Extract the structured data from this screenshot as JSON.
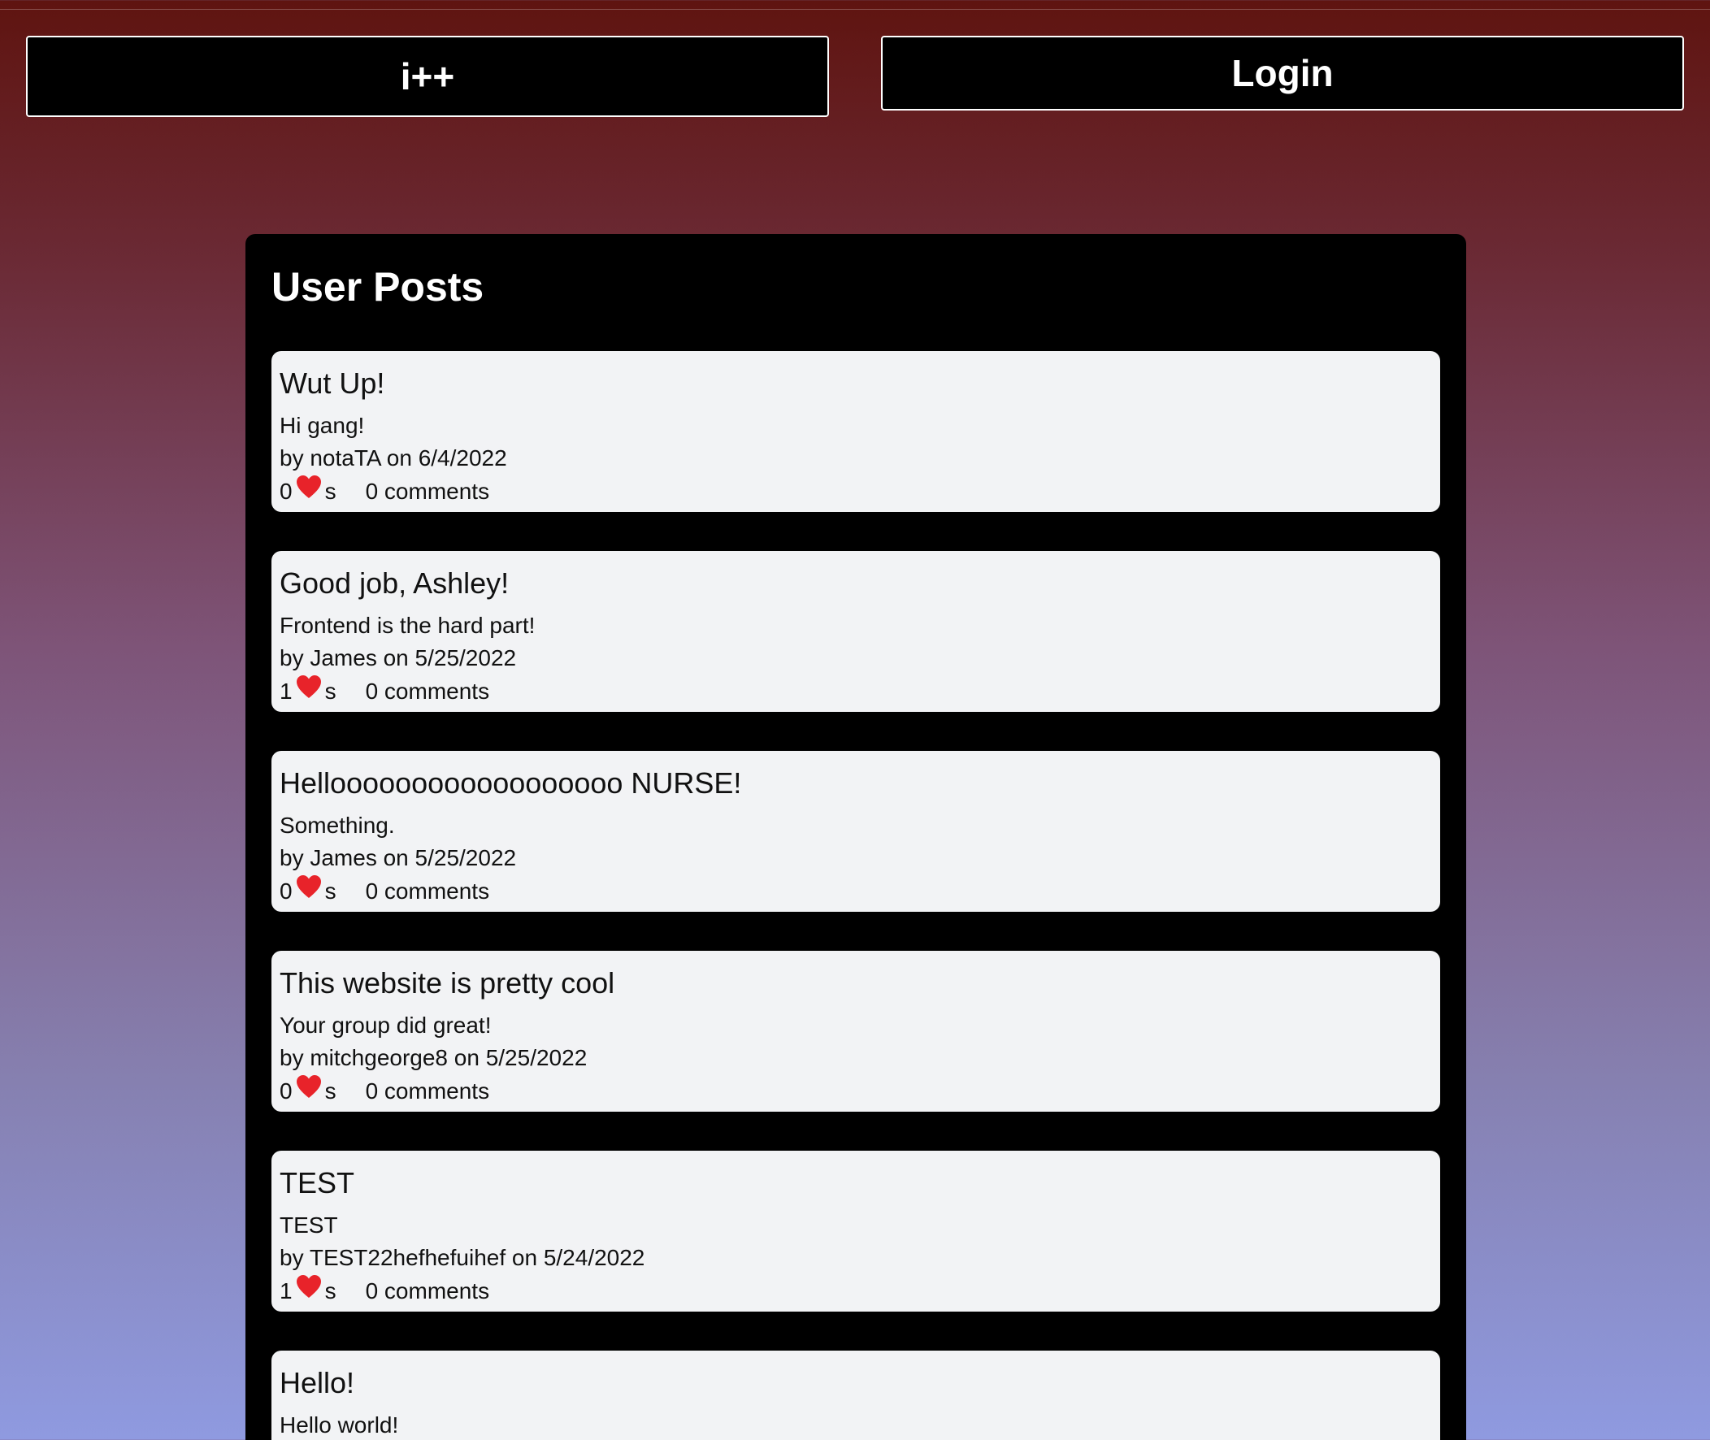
{
  "header": {
    "home_label": "i++",
    "login_label": "Login"
  },
  "panel": {
    "title": "User Posts"
  },
  "colors": {
    "heart": "#e8232a",
    "card_bg": "#f2f3f5",
    "panel_bg": "#000000"
  },
  "posts": [
    {
      "title": "Wut Up!",
      "body": "Hi gang!",
      "byline": "by notaTA on 6/4/2022",
      "likes": "0",
      "likes_suffix": "s",
      "comments": "0 comments"
    },
    {
      "title": "Good job, Ashley!",
      "body": "Frontend is the hard part!",
      "byline": "by James on 5/25/2022",
      "likes": "1",
      "likes_suffix": "s",
      "comments": "0 comments"
    },
    {
      "title": "Helloooooooooooooooooo NURSE!",
      "body": "Something.",
      "byline": "by James on 5/25/2022",
      "likes": "0",
      "likes_suffix": "s",
      "comments": "0 comments"
    },
    {
      "title": "This website is pretty cool",
      "body": "Your group did great!",
      "byline": "by mitchgeorge8 on 5/25/2022",
      "likes": "0",
      "likes_suffix": "s",
      "comments": "0 comments"
    },
    {
      "title": "TEST",
      "body": "TEST",
      "byline": "by TEST22hefhefuihef on 5/24/2022",
      "likes": "1",
      "likes_suffix": "s",
      "comments": "0 comments"
    },
    {
      "title": "Hello!",
      "body": "Hello world!",
      "byline": "",
      "likes": "",
      "likes_suffix": "",
      "comments": ""
    }
  ]
}
